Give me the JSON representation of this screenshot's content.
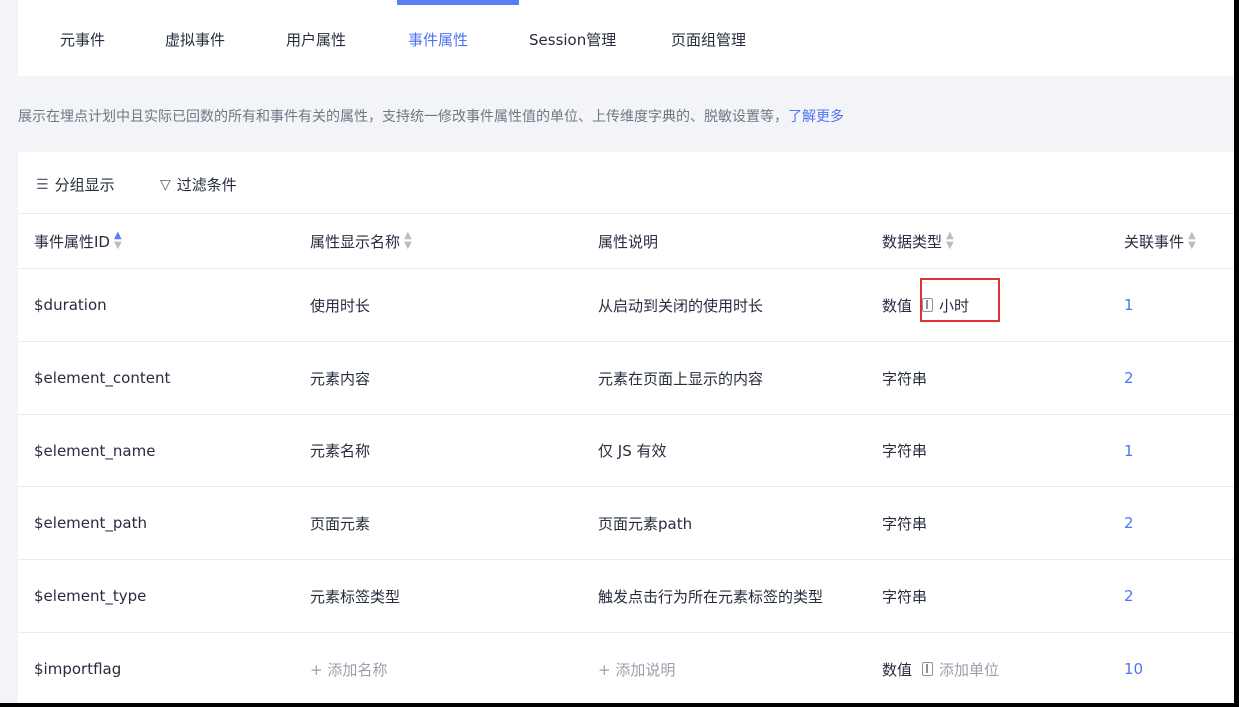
{
  "tabs": [
    {
      "label": "元事件"
    },
    {
      "label": "虚拟事件"
    },
    {
      "label": "用户属性"
    },
    {
      "label": "事件属性",
      "active": true
    },
    {
      "label": "Session管理"
    },
    {
      "label": "页面组管理"
    }
  ],
  "description": {
    "text": "展示在埋点计划中且实际已回数的所有和事件有关的属性，支持统一修改事件属性值的单位、上传维度字典的、脱敏设置等，",
    "link": "了解更多"
  },
  "toolbar": {
    "group_label": "分组显示",
    "filter_label": "过滤条件"
  },
  "table": {
    "columns": [
      "事件属性ID",
      "属性显示名称",
      "属性说明",
      "数据类型",
      "关联事件"
    ],
    "rows": [
      {
        "id": "$duration",
        "name": "使用时长",
        "desc": "从启动到关闭的使用时长",
        "type": "数值",
        "unit": "小时",
        "events": "1"
      },
      {
        "id": "$element_content",
        "name": "元素内容",
        "desc": "元素在页面上显示的内容",
        "type": "字符串",
        "events": "2"
      },
      {
        "id": "$element_name",
        "name": "元素名称",
        "desc": "仅 JS 有效",
        "type": "字符串",
        "events": "1"
      },
      {
        "id": "$element_path",
        "name": "页面元素",
        "desc": "页面元素path",
        "type": "字符串",
        "events": "2"
      },
      {
        "id": "$element_type",
        "name": "元素标签类型",
        "desc": "触发点击行为所在元素标签的类型",
        "type": "字符串",
        "events": "2"
      },
      {
        "id": "$importflag",
        "name": "+ 添加名称",
        "desc": "+ 添加说明",
        "type": "数值",
        "unit": "添加单位",
        "events": "10"
      }
    ]
  },
  "colors": {
    "accent": "#4d75f5",
    "highlight_box": "#e12f34"
  }
}
